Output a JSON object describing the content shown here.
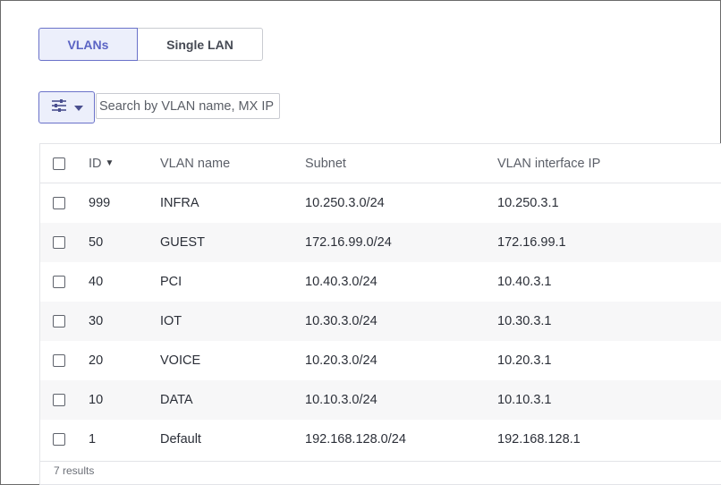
{
  "toggle": {
    "vlans_label": "VLANs",
    "single_lan_label": "Single LAN"
  },
  "search": {
    "placeholder": "Search by VLAN name, MX IP"
  },
  "table": {
    "columns": {
      "id": "ID",
      "sort_indicator": "▼",
      "vlan_name": "VLAN name",
      "subnet": "Subnet",
      "vlan_interface_ip": "VLAN interface IP"
    },
    "rows": [
      {
        "id": "999",
        "name": "INFRA",
        "subnet": "10.250.3.0/24",
        "ip": "10.250.3.1"
      },
      {
        "id": "50",
        "name": "GUEST",
        "subnet": "172.16.99.0/24",
        "ip": "172.16.99.1"
      },
      {
        "id": "40",
        "name": "PCI",
        "subnet": "10.40.3.0/24",
        "ip": "10.40.3.1"
      },
      {
        "id": "30",
        "name": "IOT",
        "subnet": "10.30.3.0/24",
        "ip": "10.30.3.1"
      },
      {
        "id": "20",
        "name": "VOICE",
        "subnet": "10.20.3.0/24",
        "ip": "10.20.3.1"
      },
      {
        "id": "10",
        "name": "DATA",
        "subnet": "10.10.3.0/24",
        "ip": "10.10.3.1"
      },
      {
        "id": "1",
        "name": "Default",
        "subnet": "192.168.128.0/24",
        "ip": "192.168.128.1"
      }
    ],
    "results_text": "7 results"
  },
  "icons": {
    "filter": "sliders-icon",
    "dropdown": "caret-down-icon"
  },
  "colors": {
    "accent": "#5a63c4",
    "accent_bg": "#eceffb",
    "row_alt": "#f7f7f8"
  }
}
